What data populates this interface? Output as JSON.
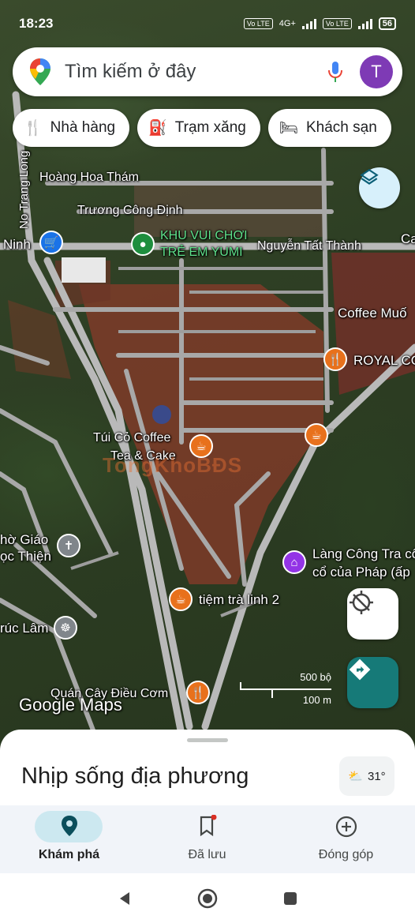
{
  "status": {
    "time": "18:23",
    "net1": "Vo LTE",
    "net2": "4G+",
    "net3": "Vo LTE",
    "battery": "56"
  },
  "search": {
    "placeholder": "Tìm kiếm ở đây",
    "avatar_letter": "T"
  },
  "chips": [
    {
      "label": "Nhà hàng",
      "icon": "fork-knife-icon"
    },
    {
      "label": "Trạm xăng",
      "icon": "gas-station-icon"
    },
    {
      "label": "Khách sạn",
      "icon": "bed-icon"
    }
  ],
  "map": {
    "streets": [
      "Hoàng Hoa Thám",
      "Trương Công Định",
      "Nguyễn Tất Thành",
      "No Trang Long"
    ],
    "places": {
      "ninh": "Ninh",
      "yumi_1": "KHU VUI CHƠI",
      "yumi_2": "TRẺ EM YUMI",
      "ca": "Ca",
      "coffee_muoi": "Coffee Muố",
      "royal": "ROYAL CO",
      "tui_co_1": "Túi Cỏ Coffee",
      "tui_co_2": "Tea & Cake",
      "giao_1": "hờ Giáo",
      "giao_2": "ọc Thiện",
      "lang_1": "Làng Công Tra cổ",
      "lang_2": "cổ của Pháp (ấp",
      "tiem_tra": "tiệm trà linh 2",
      "truc_lam": "rúc Lâm",
      "quan_cay": "Quán Cây Điều Cơm"
    },
    "watermark": "TongKhoBĐS",
    "scale_top": "500 bộ",
    "scale_bottom": "100 m",
    "logo": "Google Maps"
  },
  "sheet": {
    "title": "Nhịp sống địa phương",
    "temperature": "31°"
  },
  "nav": [
    {
      "label": "Khám phá",
      "active": true
    },
    {
      "label": "Đã lưu",
      "active": false
    },
    {
      "label": "Đóng góp",
      "active": false
    }
  ],
  "colors": {
    "accent": "#167a78",
    "avatar": "#7e3ab5",
    "poi_orange": "#e8711c",
    "poi_green": "#1e8e3e",
    "poi_purple": "#9334e6",
    "poi_blue": "#1a73e8"
  }
}
